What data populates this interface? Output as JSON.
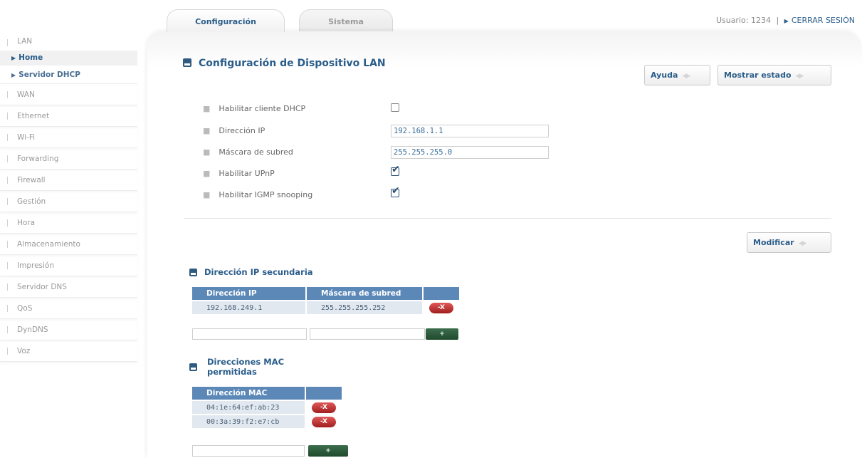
{
  "tabs": [
    {
      "label": "Configuración"
    },
    {
      "label": "Sistema"
    }
  ],
  "user": {
    "label": "Usuario: 1234",
    "separator": "|",
    "logout": "CERRAR SESIÓN"
  },
  "sidebar": {
    "lan": "LAN",
    "home": "Home",
    "dhcp": "Servidor DHCP",
    "items": [
      "WAN",
      "Ethernet",
      "Wi-Fi",
      "Forwarding",
      "Firewall",
      "Gestión",
      "Hora",
      "Almacenamiento",
      "Impresión",
      "Servidor DNS",
      "QoS",
      "DynDNS",
      "Voz"
    ]
  },
  "main": {
    "title": "Configuración de Dispositivo LAN",
    "help_button": "Ayuda",
    "status_button": "Mostrar estado",
    "modify_button": "Modificar",
    "fields": {
      "dhcp_client_label": "Habilitar cliente DHCP",
      "ip_label": "Dirección IP",
      "ip_value": "192.168.1.1",
      "mask_label": "Máscara de subred",
      "mask_value": "255.255.255.0",
      "upnp_label": "Habilitar UPnP",
      "igmp_label": "Habilitar IGMP snooping"
    },
    "checkbox_state": {
      "dhcp_client": false,
      "upnp": true,
      "igmp": true
    }
  },
  "secondary_ip": {
    "title": "Dirección IP secundaria",
    "headers": [
      "Dirección IP",
      "Máscara de subred"
    ],
    "rows": [
      {
        "ip": "192.168.249.1",
        "mask": "255.255.255.252"
      }
    ]
  },
  "mac": {
    "title_line1": "Direcciones MAC",
    "title_line2": "permitidas",
    "header": "Dirección MAC",
    "rows": [
      "04:1e:64:ef:ab:23",
      "00:3a:39:f2:e7:cb"
    ]
  },
  "actions": {
    "delete": "-X",
    "add": "+"
  },
  "icons": {
    "section": "section-square-icon",
    "arrow": "double-arrow-icon",
    "triangle": "triangle-right-icon"
  },
  "colors": {
    "accent": "#2a5d8a",
    "table_header": "#5c88b8",
    "table_cell": "#e1e8ef",
    "delete": "#b52828",
    "add": "#2c5c3c"
  }
}
